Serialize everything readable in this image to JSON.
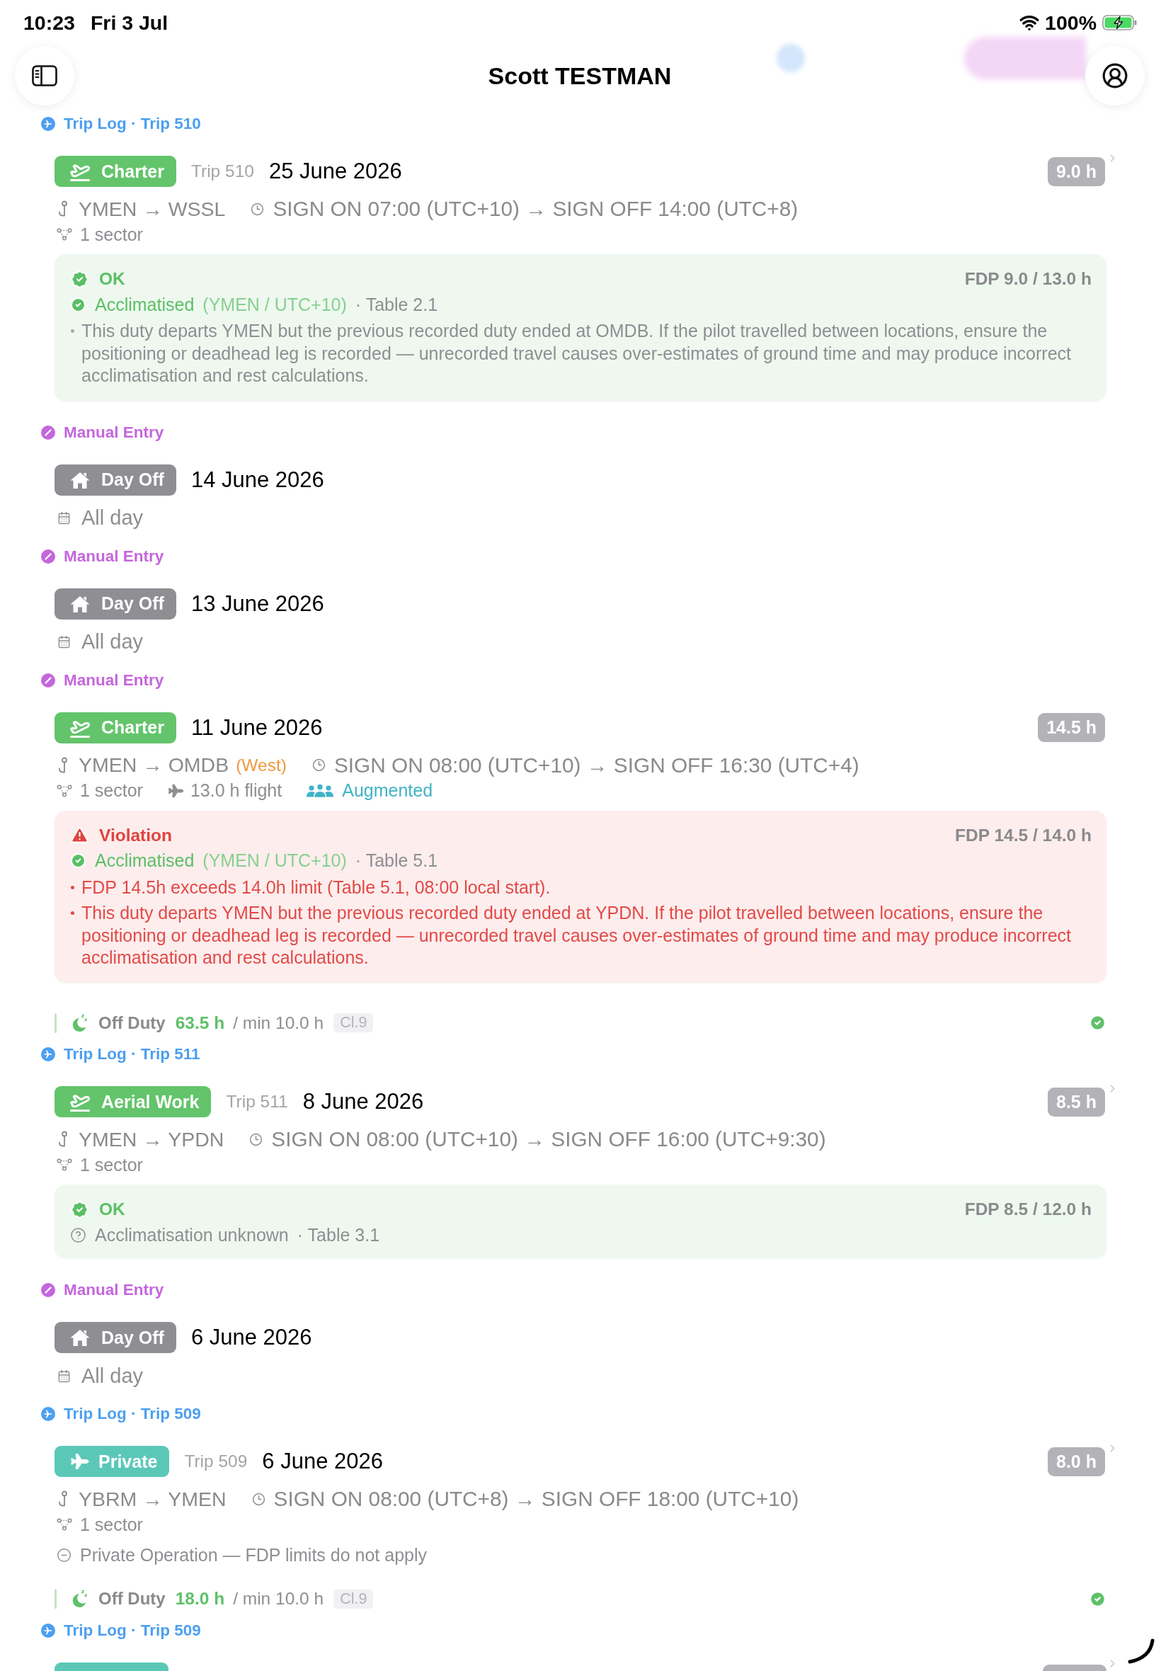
{
  "status_bar": {
    "time": "10:23",
    "date": "Fri 3 Jul",
    "battery": "100%",
    "charging": true
  },
  "header": {
    "title": "Scott TESTMAN"
  },
  "entries": [
    {
      "source": {
        "kind": "trip_log",
        "label": "Trip Log · Trip 510"
      },
      "card": {
        "category": {
          "kind": "charter",
          "label": "Charter"
        },
        "trip": "Trip 510",
        "date": "25 June 2026",
        "hours": "9.0 h",
        "disclosure": true,
        "route": "YMEN → WSSL",
        "times": "SIGN ON 07:00 (UTC+10) → SIGN OFF 14:00 (UTC+8)",
        "meta": [
          {
            "kind": "sectors",
            "text": "1 sector"
          }
        ],
        "check": {
          "kind": "ok",
          "title": "OK",
          "fdp": "FDP 9.0 / 13.0 h",
          "acclimatisation": {
            "kind": "acclimatised",
            "label": "Acclimatised",
            "detail": "(YMEN / UTC+10)",
            "table": "· Table 2.1"
          },
          "notes": [
            "This duty departs YMEN but the previous recorded duty ended at OMDB. If the pilot travelled between locations, ensure the positioning or deadhead leg is recorded — unrecorded travel causes over-estimates of ground time and may produce incorrect acclimatisation and rest calculations."
          ]
        }
      }
    },
    {
      "source": {
        "kind": "manual",
        "label": "Manual Entry"
      },
      "card": {
        "category": {
          "kind": "day_off",
          "label": "Day Off"
        },
        "date": "14 June 2026",
        "disclosure": false,
        "schedule": "All day"
      }
    },
    {
      "source": {
        "kind": "manual",
        "label": "Manual Entry"
      },
      "card": {
        "category": {
          "kind": "day_off",
          "label": "Day Off"
        },
        "date": "13 June 2026",
        "disclosure": false,
        "schedule": "All day"
      }
    },
    {
      "source": {
        "kind": "manual",
        "label": "Manual Entry"
      },
      "card": {
        "category": {
          "kind": "charter",
          "label": "Charter"
        },
        "date": "11 June 2026",
        "hours": "14.5 h",
        "disclosure": false,
        "route": "YMEN → OMDB",
        "route_note": "(West)",
        "times": "SIGN ON 08:00 (UTC+10) → SIGN OFF 16:30 (UTC+4)",
        "meta": [
          {
            "kind": "sectors",
            "text": "1 sector"
          },
          {
            "kind": "flight",
            "text": "13.0 h flight"
          },
          {
            "kind": "augmented",
            "text": "Augmented"
          }
        ],
        "check": {
          "kind": "violation",
          "title": "Violation",
          "fdp": "FDP 14.5 / 14.0 h",
          "acclimatisation": {
            "kind": "acclimatised",
            "label": "Acclimatised",
            "detail": "(YMEN / UTC+10)",
            "table": "· Table 5.1"
          },
          "notes": [
            "FDP 14.5h exceeds 14.0h limit (Table 5.1, 08:00 local start).",
            "This duty departs YMEN but the previous recorded duty ended at YPDN. If the pilot travelled between locations, ensure the positioning or deadhead leg is recorded — unrecorded travel causes over-estimates of ground time and may produce incorrect acclimatisation and rest calculations."
          ]
        }
      },
      "rest": {
        "label": "Off Duty",
        "hours": "63.5 h",
        "minimum": "/ min 10.0 h",
        "rule": "Cl.9",
        "compliant": true
      }
    },
    {
      "source": {
        "kind": "trip_log",
        "label": "Trip Log · Trip 511"
      },
      "card": {
        "category": {
          "kind": "aerial_work",
          "label": "Aerial Work"
        },
        "trip": "Trip 511",
        "date": "8 June 2026",
        "hours": "8.5 h",
        "disclosure": true,
        "route": "YMEN → YPDN",
        "times": "SIGN ON 08:00 (UTC+10) → SIGN OFF 16:00 (UTC+9:30)",
        "meta": [
          {
            "kind": "sectors",
            "text": "1 sector"
          }
        ],
        "check": {
          "kind": "ok",
          "title": "OK",
          "fdp": "FDP 8.5 / 12.0 h",
          "acclimatisation": {
            "kind": "unknown",
            "label": "Acclimatisation unknown",
            "table": "· Table 3.1"
          }
        }
      }
    },
    {
      "source": {
        "kind": "manual",
        "label": "Manual Entry"
      },
      "card": {
        "category": {
          "kind": "day_off",
          "label": "Day Off"
        },
        "date": "6 June 2026",
        "disclosure": false,
        "schedule": "All day"
      }
    },
    {
      "source": {
        "kind": "trip_log",
        "label": "Trip Log · Trip 509"
      },
      "card": {
        "category": {
          "kind": "private",
          "label": "Private"
        },
        "trip": "Trip 509",
        "date": "6 June 2026",
        "hours": "8.0 h",
        "disclosure": true,
        "route": "YBRM → YMEN",
        "times": "SIGN ON 08:00 (UTC+8) → SIGN OFF 18:00 (UTC+10)",
        "meta": [
          {
            "kind": "sectors",
            "text": "1 sector"
          }
        ],
        "note": {
          "kind": "not_applicable",
          "text": "Private Operation — FDP limits do not apply"
        }
      },
      "rest": {
        "label": "Off Duty",
        "hours": "18.0 h",
        "minimum": "/ min 10.0 h",
        "rule": "Cl.9",
        "compliant": true
      }
    },
    {
      "source": {
        "kind": "trip_log",
        "label": "Trip Log · Trip 509"
      },
      "peek": {
        "category": {
          "kind": "private"
        },
        "disclosure": true
      }
    }
  ]
}
